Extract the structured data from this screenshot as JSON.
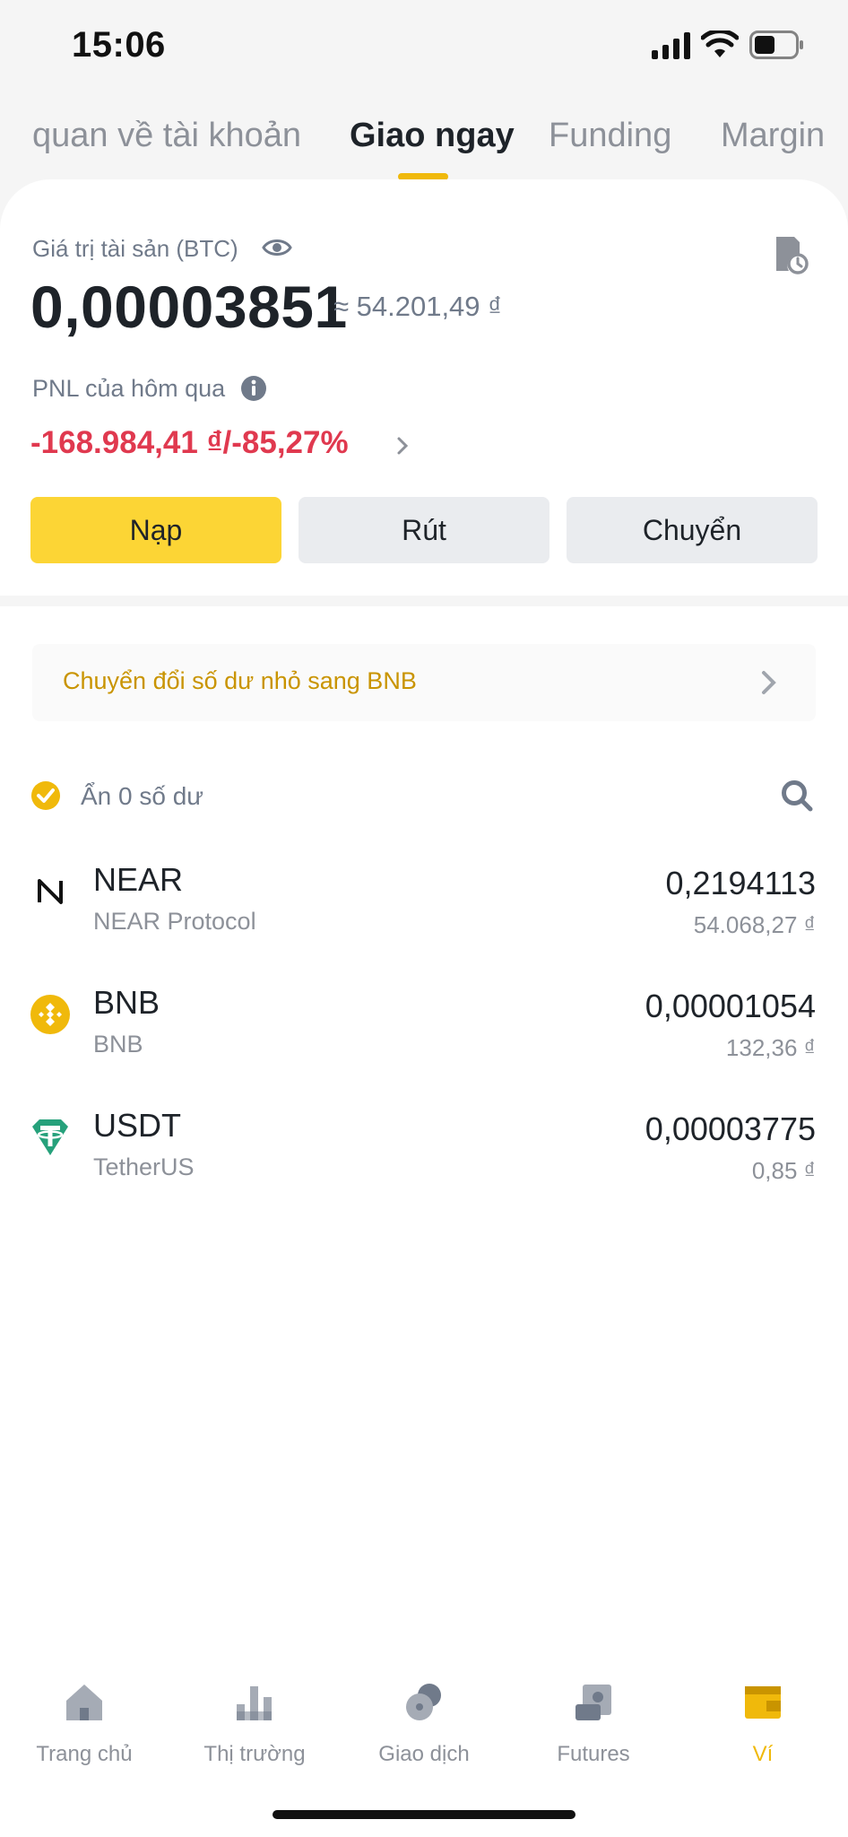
{
  "status_bar": {
    "time": "15:06"
  },
  "tabs": [
    {
      "label": "quan về tài khoản",
      "active": false
    },
    {
      "label": "Giao ngay",
      "active": true
    },
    {
      "label": "Funding",
      "active": false
    },
    {
      "label": "Margin",
      "active": false
    }
  ],
  "summary": {
    "asset_label": "Giá trị tài sản (BTC)",
    "btc_value": "0,00003851",
    "fiat_value": "≈ 54.201,49 ₫",
    "pnl_label": "PNL của hôm qua",
    "pnl_value": "-168.984,41 ₫/-85,27%"
  },
  "actions": {
    "deposit": "Nạp",
    "withdraw": "Rút",
    "transfer": "Chuyển"
  },
  "convert_banner": {
    "text": "Chuyển đổi số dư nhỏ sang BNB"
  },
  "filter": {
    "hide_zero_label": "Ẩn 0 số dư",
    "hide_zero_checked": true
  },
  "assets": [
    {
      "symbol": "NEAR",
      "name": "NEAR Protocol",
      "amount": "0,2194113",
      "fiat": "54.068,27 ₫",
      "icon": "near-icon"
    },
    {
      "symbol": "BNB",
      "name": "BNB",
      "amount": "0,00001054",
      "fiat": "132,36 ₫",
      "icon": "bnb-icon"
    },
    {
      "symbol": "USDT",
      "name": "TetherUS",
      "amount": "0,00003775",
      "fiat": "0,85 ₫",
      "icon": "usdt-icon"
    }
  ],
  "bottom_nav": [
    {
      "label": "Trang chủ",
      "icon": "home-icon",
      "active": false
    },
    {
      "label": "Thị trường",
      "icon": "markets-icon",
      "active": false
    },
    {
      "label": "Giao dịch",
      "icon": "trade-icon",
      "active": false
    },
    {
      "label": "Futures",
      "icon": "futures-icon",
      "active": false
    },
    {
      "label": "Ví",
      "icon": "wallet-icon",
      "active": true
    }
  ],
  "colors": {
    "accent": "#f0b90b",
    "button_primary": "#fcd535",
    "negative": "#e0394f",
    "muted": "#707a8a"
  }
}
